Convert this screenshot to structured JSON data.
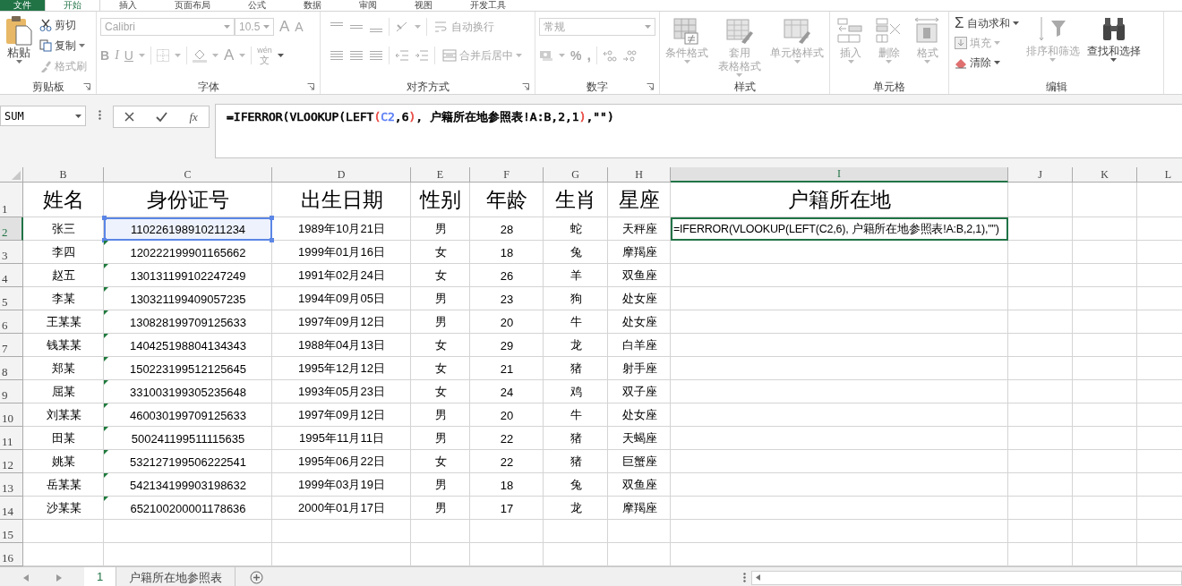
{
  "ribbon_tabs": [
    {
      "label": "文件",
      "kind": "file",
      "selected": false
    },
    {
      "label": "开始",
      "kind": "tab",
      "selected": true
    },
    {
      "label": "插入",
      "kind": "tab",
      "selected": false
    },
    {
      "label": "页面布局",
      "kind": "tab",
      "selected": false
    },
    {
      "label": "公式",
      "kind": "tab",
      "selected": false
    },
    {
      "label": "数据",
      "kind": "tab",
      "selected": false
    },
    {
      "label": "审阅",
      "kind": "tab",
      "selected": false
    },
    {
      "label": "视图",
      "kind": "tab",
      "selected": false
    },
    {
      "label": "开发工具",
      "kind": "tab",
      "selected": false
    }
  ],
  "clipboard": {
    "paste": "粘贴",
    "cut": "剪切",
    "copy": "复制",
    "format_painter": {
      "label": "格式刷",
      "disabled": true
    },
    "group_label": "剪贴板"
  },
  "font": {
    "disabled": true,
    "name": "Calibri",
    "size": "10.5",
    "grow": "A",
    "shrink": "A",
    "bold": "B",
    "italic": "I",
    "underline": "U",
    "font_color": "A",
    "phonetic_top": "wén",
    "phonetic_bottom": "文",
    "group_label": "字体"
  },
  "alignment": {
    "disabled": true,
    "wrap_text": "自动换行",
    "merge_center": "合并后居中",
    "group_label": "对齐方式"
  },
  "number": {
    "disabled": true,
    "format": "常规",
    "percent": "%",
    "comma": ",",
    "group_label": "数字"
  },
  "styles": {
    "buttons": [
      {
        "label": "条件格式",
        "kind": "conditional",
        "disabled": true
      },
      {
        "label": "套用",
        "label_2": "表格格式",
        "kind": "table",
        "disabled": true
      },
      {
        "label": "单元格样式",
        "kind": "cellstyle",
        "disabled": true
      }
    ],
    "group_label": "样式"
  },
  "cells": {
    "buttons": [
      {
        "label": "插入",
        "kind": "insert",
        "disabled": true
      },
      {
        "label": "删除",
        "kind": "delete",
        "disabled": true
      },
      {
        "label": "格式",
        "kind": "format",
        "disabled": true
      }
    ],
    "group_label": "单元格"
  },
  "editing": {
    "small": [
      {
        "label": "自动求和",
        "symbol": "Σ",
        "kind": "sum",
        "disabled": false
      },
      {
        "label": "填充",
        "kind": "fill",
        "disabled": true
      },
      {
        "label": "清除",
        "kind": "clear",
        "disabled": false
      }
    ],
    "big": [
      {
        "label": "排序和筛选",
        "kind": "sort",
        "disabled": true
      },
      {
        "label": "查找和选择",
        "kind": "find",
        "disabled": false
      }
    ],
    "group_label": "编辑"
  },
  "formula_bar": {
    "name_box": "SUM",
    "function_label": "fx",
    "formula": [
      {
        "text": "=IFERROR(VLOOKUP(LEFT",
        "color": "#000000"
      },
      {
        "text": "(",
        "color": "#e8463f"
      },
      {
        "text": "C2",
        "color": "#5b7ff5"
      },
      {
        "text": ",6",
        "color": "#000000"
      },
      {
        "text": ")",
        "color": "#e8463f"
      },
      {
        "text": ", 户籍所在地参照表!A:B,2,1",
        "color": "#000000"
      },
      {
        "text": ")",
        "color": "#e8463f"
      },
      {
        "text": ",\"\")",
        "color": "#000000"
      }
    ]
  },
  "sheet": {
    "columns": [
      {
        "label": "B",
        "selected": false
      },
      {
        "label": "C",
        "selected": false
      },
      {
        "label": "D",
        "selected": false
      },
      {
        "label": "E",
        "selected": false
      },
      {
        "label": "F",
        "selected": false
      },
      {
        "label": "G",
        "selected": false
      },
      {
        "label": "H",
        "selected": false
      },
      {
        "label": "I",
        "selected": true
      },
      {
        "label": "J",
        "selected": false
      },
      {
        "label": "K",
        "selected": false
      },
      {
        "label": "L",
        "selected": false
      }
    ],
    "row_numbers": [
      {
        "label": "1",
        "selected": false
      },
      {
        "label": "2",
        "selected": true
      },
      {
        "label": "3",
        "selected": false
      },
      {
        "label": "4",
        "selected": false
      },
      {
        "label": "5",
        "selected": false
      },
      {
        "label": "6",
        "selected": false
      },
      {
        "label": "7",
        "selected": false
      },
      {
        "label": "8",
        "selected": false
      },
      {
        "label": "9",
        "selected": false
      },
      {
        "label": "10",
        "selected": false
      },
      {
        "label": "11",
        "selected": false
      },
      {
        "label": "12",
        "selected": false
      },
      {
        "label": "13",
        "selected": false
      },
      {
        "label": "14",
        "selected": false
      },
      {
        "label": "15",
        "selected": false
      },
      {
        "label": "16",
        "selected": false
      }
    ],
    "header": [
      "姓名",
      "身份证号",
      "出生日期",
      "性别",
      "年龄",
      "生肖",
      "星座",
      "户籍所在地"
    ],
    "rows": [
      {
        "cells": [
          "张三",
          "110226198910211234",
          "1989年10月21日",
          "男",
          "28",
          "蛇",
          "天秤座"
        ],
        "error_flag": false,
        "referenced": true,
        "editing": [
          {
            "text": "=IFERROR(VLOOKUP(LEFT(",
            "color": "#000000"
          },
          {
            "text": "C2",
            "color": "#000000"
          },
          {
            "text": ",6), 户籍所在地参照表!A:B,2,1),\"\")",
            "color": "#000000"
          }
        ]
      },
      {
        "cells": [
          "李四",
          "120222199901165662",
          "1999年01月16日",
          "女",
          "18",
          "兔",
          "摩羯座"
        ],
        "error_flag": true,
        "referenced": false
      },
      {
        "cells": [
          "赵五",
          "130131199102247249",
          "1991年02月24日",
          "女",
          "26",
          "羊",
          "双鱼座"
        ],
        "error_flag": true,
        "referenced": false
      },
      {
        "cells": [
          "李某",
          "130321199409057235",
          "1994年09月05日",
          "男",
          "23",
          "狗",
          "处女座"
        ],
        "error_flag": true,
        "referenced": false
      },
      {
        "cells": [
          "王某某",
          "130828199709125633",
          "1997年09月12日",
          "男",
          "20",
          "牛",
          "处女座"
        ],
        "error_flag": true,
        "referenced": false
      },
      {
        "cells": [
          "钱某某",
          "140425198804134343",
          "1988年04月13日",
          "女",
          "29",
          "龙",
          "白羊座"
        ],
        "error_flag": true,
        "referenced": false
      },
      {
        "cells": [
          "郑某",
          "150223199512125645",
          "1995年12月12日",
          "女",
          "21",
          "猪",
          "射手座"
        ],
        "error_flag": true,
        "referenced": false
      },
      {
        "cells": [
          "屈某",
          "331003199305235648",
          "1993年05月23日",
          "女",
          "24",
          "鸡",
          "双子座"
        ],
        "error_flag": true,
        "referenced": false
      },
      {
        "cells": [
          "刘某某",
          "460030199709125633",
          "1997年09月12日",
          "男",
          "20",
          "牛",
          "处女座"
        ],
        "error_flag": true,
        "referenced": false
      },
      {
        "cells": [
          "田某",
          "500241199511115635",
          "1995年11月11日",
          "男",
          "22",
          "猪",
          "天蝎座"
        ],
        "error_flag": true,
        "referenced": false
      },
      {
        "cells": [
          "姚某",
          "532127199506222541",
          "1995年06月22日",
          "女",
          "22",
          "猪",
          "巨蟹座"
        ],
        "error_flag": true,
        "referenced": false
      },
      {
        "cells": [
          "岳某某",
          "542134199903198632",
          "1999年03月19日",
          "男",
          "18",
          "兔",
          "双鱼座"
        ],
        "error_flag": true,
        "referenced": false
      },
      {
        "cells": [
          "沙某某",
          "652100200001178636",
          "2000年01月17日",
          "男",
          "17",
          "龙",
          "摩羯座"
        ],
        "error_flag": true,
        "referenced": false
      }
    ]
  },
  "sheet_tabs": [
    {
      "label": "1",
      "selected": true
    },
    {
      "label": "户籍所在地参照表",
      "selected": false
    }
  ]
}
